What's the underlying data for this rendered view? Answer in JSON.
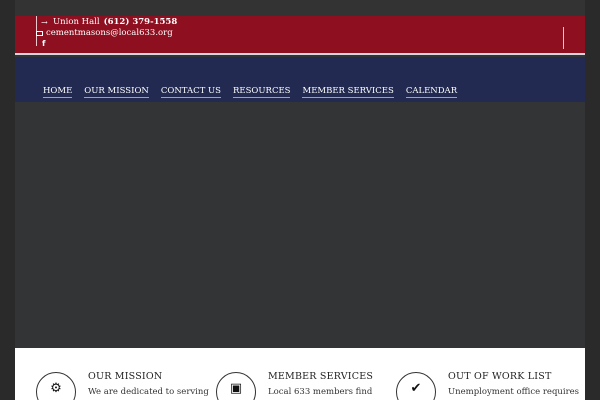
{
  "topbar": {
    "phone_prefix": "Union Hall",
    "phone_number": "(612) 379-1558",
    "email": "cementmasons@local633.org",
    "social_icon_label": "f",
    "arrow_icon": "→"
  },
  "nav": {
    "items": [
      "HOME",
      "OUR MISSION",
      "CONTACT US",
      "RESOURCES",
      "MEMBER SERVICES",
      "CALENDAR"
    ]
  },
  "features": [
    {
      "title": "OUR MISSION",
      "text": "We are dedicated to serving",
      "icon": "gear-icon",
      "glyph": "⚙"
    },
    {
      "title": "MEMBER SERVICES",
      "text": "Local 633 members find",
      "icon": "address-book-icon",
      "glyph": "▣"
    },
    {
      "title": "OUT OF WORK LIST",
      "text": "Unemployment office requires",
      "icon": "check-icon",
      "glyph": "✔"
    }
  ],
  "colors": {
    "topbar": "#8e0f1f",
    "navbar": "#222a52",
    "hero": "#333435",
    "outer": "#2a2a2a"
  }
}
